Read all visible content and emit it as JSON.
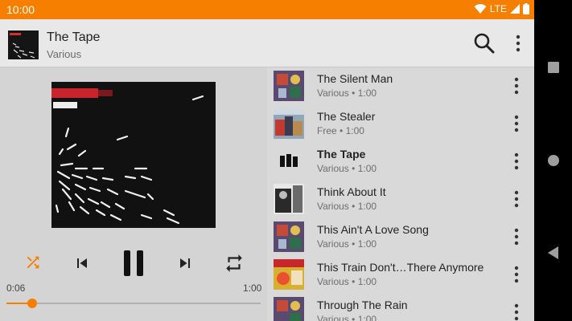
{
  "status_bar": {
    "time": "10:00",
    "network": "LTE",
    "icons": [
      "wifi-icon",
      "signal-icon",
      "battery-icon"
    ],
    "color": "#f67f00"
  },
  "app_bar": {
    "title": "The Tape",
    "subtitle": "Various",
    "actions": [
      "search-icon",
      "more-vert-icon"
    ]
  },
  "player": {
    "elapsed": "0:06",
    "duration": "1:00",
    "progress": 0.1,
    "shuffle_on": true,
    "accent": "#f67f00",
    "controls": [
      "shuffle-icon",
      "skip-previous-icon",
      "pause-icon",
      "skip-next-icon",
      "repeat-icon"
    ]
  },
  "tracks": [
    {
      "title": "The Silent Man",
      "artist": "Various",
      "duration": "1:00"
    },
    {
      "title": "The Stealer",
      "artist": "Free",
      "duration": "1:00"
    },
    {
      "title": "The Tape",
      "artist": "Various",
      "duration": "1:00",
      "current": true
    },
    {
      "title": "Think About It",
      "artist": "Various",
      "duration": "1:00"
    },
    {
      "title": "This Ain't A Love Song",
      "artist": "Various",
      "duration": "1:00"
    },
    {
      "title": "This Train Don't…There Anymore",
      "artist": "Various",
      "duration": "1:00"
    },
    {
      "title": "Through The Rain",
      "artist": "Various",
      "duration": "1:00"
    }
  ],
  "separator": "•"
}
